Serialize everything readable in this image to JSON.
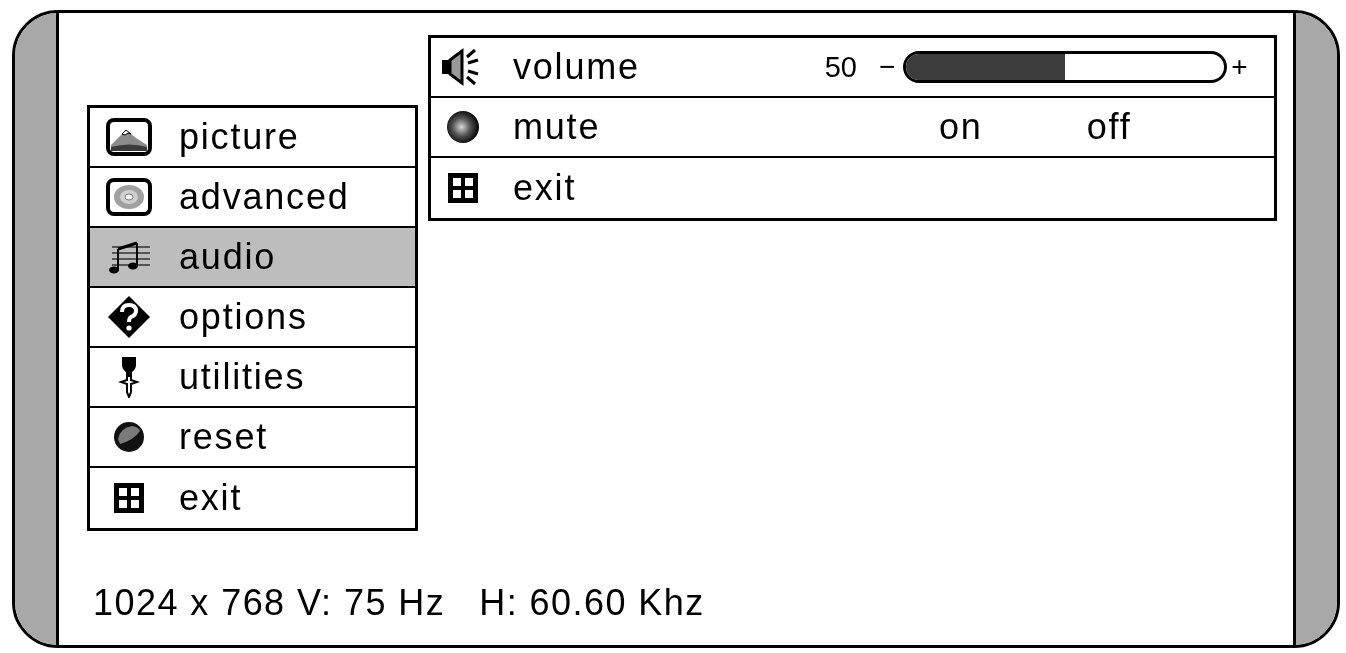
{
  "menu": {
    "items": [
      {
        "kind": "picture",
        "label": "picture",
        "selected": false
      },
      {
        "kind": "advanced",
        "label": "advanced",
        "selected": false
      },
      {
        "kind": "audio",
        "label": "audio",
        "selected": true
      },
      {
        "kind": "options",
        "label": "options",
        "selected": false
      },
      {
        "kind": "utilities",
        "label": "utilities",
        "selected": false
      },
      {
        "kind": "reset",
        "label": "reset",
        "selected": false
      },
      {
        "kind": "exit",
        "label": "exit",
        "selected": false
      }
    ]
  },
  "submenu": {
    "rows": [
      {
        "kind": "slider",
        "label": "volume",
        "value": "50",
        "minus": "−",
        "plus": "+",
        "level": 0.5
      },
      {
        "kind": "toggle",
        "label": "mute",
        "options": [
          "on",
          "off"
        ]
      },
      {
        "kind": "exit",
        "label": "exit"
      }
    ]
  },
  "status_bar": {
    "resolution": "1024 x 768 V: 75 Hz",
    "frequency": "H: 60.60 Khz"
  }
}
